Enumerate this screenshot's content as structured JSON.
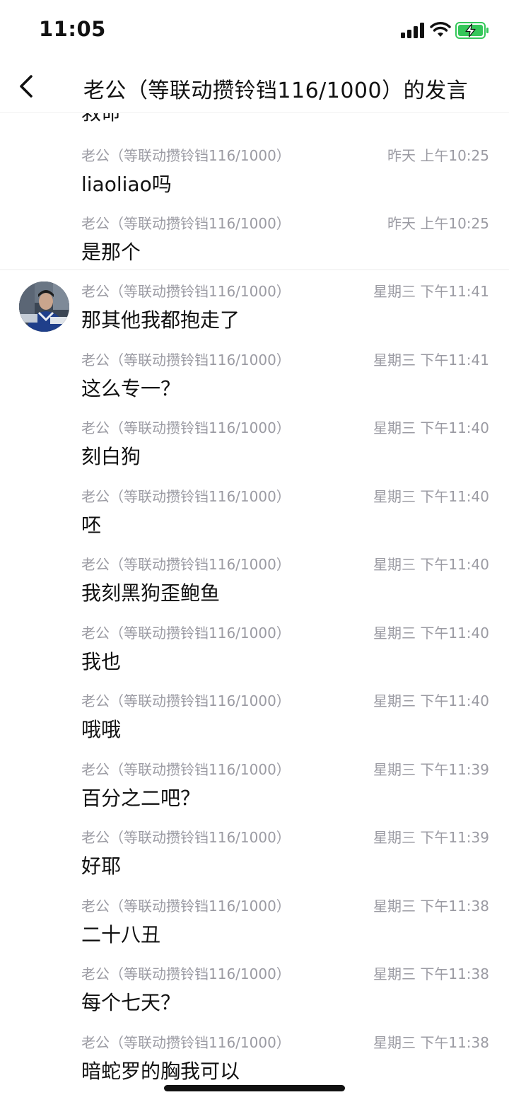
{
  "status_bar": {
    "time": "11:05"
  },
  "header": {
    "title": "老公（等联动攒铃铛116/1000）的发言"
  },
  "partial_top_text": "救命",
  "messages": [
    {
      "sender": "老公（等联动攒铃铛116/1000）",
      "time": "昨天 上午10:25",
      "text": "liaoliao吗"
    },
    {
      "sender": "老公（等联动攒铃铛116/1000）",
      "time": "昨天 上午10:25",
      "text": "是那个"
    },
    {
      "sender": "老公（等联动攒铃铛116/1000）",
      "time": "星期三 下午11:41",
      "text": "那其他我都抱走了"
    },
    {
      "sender": "老公（等联动攒铃铛116/1000）",
      "time": "星期三 下午11:41",
      "text": "这么专一？"
    },
    {
      "sender": "老公（等联动攒铃铛116/1000）",
      "time": "星期三 下午11:40",
      "text": "刻白狗"
    },
    {
      "sender": "老公（等联动攒铃铛116/1000）",
      "time": "星期三 下午11:40",
      "text": "呸"
    },
    {
      "sender": "老公（等联动攒铃铛116/1000）",
      "time": "星期三 下午11:40",
      "text": "我刻黑狗歪鲍鱼"
    },
    {
      "sender": "老公（等联动攒铃铛116/1000）",
      "time": "星期三 下午11:40",
      "text": "我也"
    },
    {
      "sender": "老公（等联动攒铃铛116/1000）",
      "time": "星期三 下午11:40",
      "text": "哦哦"
    },
    {
      "sender": "老公（等联动攒铃铛116/1000）",
      "time": "星期三 下午11:39",
      "text": "百分之二吧？"
    },
    {
      "sender": "老公（等联动攒铃铛116/1000）",
      "time": "星期三 下午11:39",
      "text": "好耶"
    },
    {
      "sender": "老公（等联动攒铃铛116/1000）",
      "time": "星期三 下午11:38",
      "text": "二十八丑"
    },
    {
      "sender": "老公（等联动攒铃铛116/1000）",
      "time": "星期三 下午11:38",
      "text": "每个七天？"
    },
    {
      "sender": "老公（等联动攒铃铛116/1000）",
      "time": "星期三 下午11:38",
      "text": "暗蛇罗的胸我可以"
    }
  ]
}
